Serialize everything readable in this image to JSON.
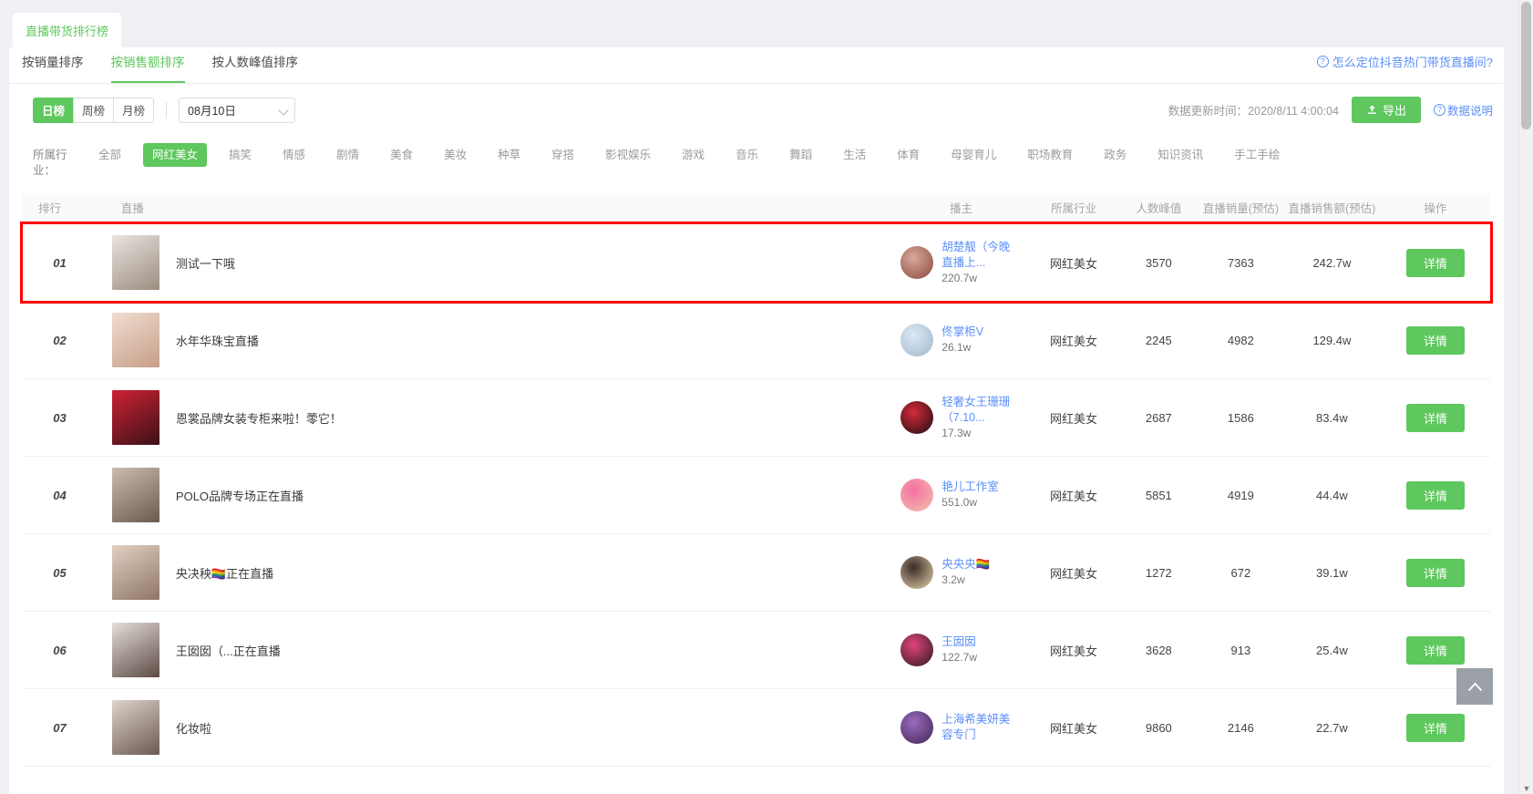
{
  "tabchip": {
    "label": "直播带货排行榜"
  },
  "sort_tabs": [
    {
      "label": "按销量排序",
      "active": false
    },
    {
      "label": "按销售额排序",
      "active": true
    },
    {
      "label": "按人数峰值排序",
      "active": false
    }
  ],
  "help_link": {
    "label": "怎么定位抖音热门带货直播间?",
    "icon": "question-circle-icon"
  },
  "period": {
    "options": [
      {
        "label": "日榜",
        "active": true
      },
      {
        "label": "周榜",
        "active": false
      },
      {
        "label": "月榜",
        "active": false
      }
    ]
  },
  "date_select": {
    "value": "08月10日",
    "icon": "chevron-down-icon"
  },
  "update_time": {
    "label": "数据更新时间：2020/8/11 4:00:04"
  },
  "export_button": {
    "label": "导出",
    "icon": "upload-icon"
  },
  "data_note": {
    "label": "数据说明",
    "icon": "question-circle-icon"
  },
  "industry": {
    "label": "所属行业：",
    "items": [
      {
        "label": "全部",
        "active": false
      },
      {
        "label": "网红美女",
        "active": true
      },
      {
        "label": "搞笑",
        "active": false
      },
      {
        "label": "情感",
        "active": false
      },
      {
        "label": "剧情",
        "active": false
      },
      {
        "label": "美食",
        "active": false
      },
      {
        "label": "美妆",
        "active": false
      },
      {
        "label": "种草",
        "active": false
      },
      {
        "label": "穿搭",
        "active": false
      },
      {
        "label": "影视娱乐",
        "active": false
      },
      {
        "label": "游戏",
        "active": false
      },
      {
        "label": "音乐",
        "active": false
      },
      {
        "label": "舞蹈",
        "active": false
      },
      {
        "label": "生活",
        "active": false
      },
      {
        "label": "体育",
        "active": false
      },
      {
        "label": "母婴育儿",
        "active": false
      },
      {
        "label": "职场教育",
        "active": false
      },
      {
        "label": "政务",
        "active": false
      },
      {
        "label": "知识资讯",
        "active": false
      },
      {
        "label": "手工手绘",
        "active": false
      }
    ]
  },
  "table": {
    "headers": {
      "rank": "排行",
      "live": "直播",
      "anchor": "播主",
      "industry": "所属行业",
      "peak": "人数峰值",
      "sales": "直播销量(预估)",
      "gmv": "直播销售额(预估)",
      "op": "操作"
    },
    "detail_label": "详情",
    "rows": [
      {
        "rank": "01",
        "title": "测试一下哦",
        "anchor_name": "胡楚靓（今晚直播上...",
        "anchor_fans": "220.7w",
        "industry": "网红美女",
        "peak": "3570",
        "sales": "7363",
        "gmv": "242.7w",
        "highlight": true,
        "thumb_c1": "#e9e4de",
        "thumb_c2": "#9b8d81",
        "avatar_c1": "#d8a89c",
        "avatar_c2": "#8a4a3d"
      },
      {
        "rank": "02",
        "title": "水年华珠宝直播",
        "anchor_name": "佟掌柜V",
        "anchor_fans": "26.1w",
        "industry": "网红美女",
        "peak": "2245",
        "sales": "4982",
        "gmv": "129.4w",
        "highlight": false,
        "thumb_c1": "#f0ddd0",
        "thumb_c2": "#c69e88",
        "avatar_c1": "#dce9f5",
        "avatar_c2": "#9fb6cc"
      },
      {
        "rank": "03",
        "title": "恩裳品牌女装专柜来啦！蕶它！",
        "anchor_name": "轻奢女王珊珊（7.10...",
        "anchor_fans": "17.3w",
        "industry": "网红美女",
        "peak": "2687",
        "sales": "1586",
        "gmv": "83.4w",
        "highlight": false,
        "thumb_c1": "#cf2233",
        "thumb_c2": "#3a1118",
        "avatar_c1": "#d42a3a",
        "avatar_c2": "#1c0c10"
      },
      {
        "rank": "04",
        "title": "POLO品牌专场正在直播",
        "anchor_name": "艳儿工作室",
        "anchor_fans": "551.0w",
        "industry": "网红美女",
        "peak": "5851",
        "sales": "4919",
        "gmv": "44.4w",
        "highlight": false,
        "thumb_c1": "#cdbcae",
        "thumb_c2": "#6a5a4e",
        "avatar_c1": "#f56fa1",
        "avatar_c2": "#f0c4b0"
      },
      {
        "rank": "05",
        "title": "央决秧🏳️‍🌈正在直播",
        "anchor_name": "央央央🏳️‍🌈",
        "anchor_fans": "3.2w",
        "industry": "网红美女",
        "peak": "1272",
        "sales": "672",
        "gmv": "39.1w",
        "highlight": false,
        "thumb_c1": "#e3d1c4",
        "thumb_c2": "#8d7565",
        "avatar_c1": "#3a2b25",
        "avatar_c2": "#e8d4ae"
      },
      {
        "rank": "06",
        "title": "王囡囡（...正在直播",
        "anchor_name": "王囡囡",
        "anchor_fans": "122.7w",
        "industry": "网红美女",
        "peak": "3628",
        "sales": "913",
        "gmv": "25.4w",
        "highlight": false,
        "thumb_c1": "#e5ded9",
        "thumb_c2": "#5d4b45",
        "avatar_c1": "#e0447c",
        "avatar_c2": "#2b1a1e"
      },
      {
        "rank": "07",
        "title": "化妆啦",
        "anchor_name": "上海希美妍美容专门",
        "anchor_fans": "",
        "industry": "网红美女",
        "peak": "9860",
        "sales": "2146",
        "gmv": "22.7w",
        "highlight": false,
        "thumb_c1": "#ded3cb",
        "thumb_c2": "#6b5a50",
        "avatar_c1": "#9a6bc0",
        "avatar_c2": "#41264f"
      }
    ]
  },
  "back_to_top": {
    "icon": "chevron-up-icon",
    "label": "︿"
  },
  "colors": {
    "brand_green": "#5ec75d",
    "link_blue": "#5b8ff9",
    "highlight_red": "#ff0000",
    "page_bg": "#eef0f3"
  }
}
